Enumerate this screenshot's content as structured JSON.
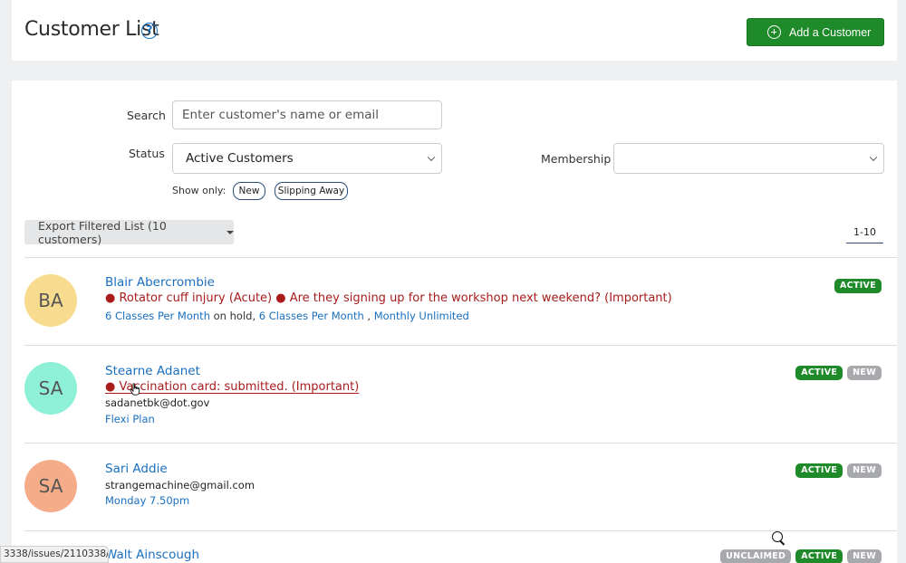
{
  "header": {
    "title": "Customer List",
    "help_glyph": "?",
    "add_button_label": "Add a Customer"
  },
  "filters": {
    "search_label": "Search",
    "search_placeholder": "Enter customer's name or email",
    "status_label": "Status",
    "status_value": "Active Customers",
    "membership_label": "Membership",
    "membership_value": "",
    "show_only_label": "Show only:",
    "show_only_options": [
      "New",
      "Slipping Away"
    ]
  },
  "toolbar": {
    "export_label": "Export Filtered List (10 customers)",
    "pagination": "1-10"
  },
  "customers": [
    {
      "initials": "BA",
      "avatar_color": "#f7dc8f",
      "name": "Blair Abercrombie",
      "note": "● Rotator cuff injury (Acute) ● Are they signing up for the workshop next weekend? (Important)",
      "email": "",
      "plans": [
        "6 Classes Per Month",
        "on hold,",
        "6 Classes Per Month",
        ",",
        "Monthly Unlimited"
      ],
      "badges": [
        "ACTIVE"
      ]
    },
    {
      "initials": "SA",
      "avatar_color": "#8ff0d8",
      "name": "Stearne Adanet",
      "note": "● Vaccination card: submitted. (Important)",
      "email": "sadanetbk@dot.gov",
      "plans": [
        "Flexi Plan"
      ],
      "badges": [
        "ACTIVE",
        "NEW"
      ]
    },
    {
      "initials": "SA",
      "avatar_color": "#f5ac88",
      "name": "Sari Addie",
      "note": "",
      "email": "strangemachine@gmail.com",
      "plans": [
        "Monday 7.50pm"
      ],
      "badges": [
        "ACTIVE",
        "NEW"
      ]
    },
    {
      "initials": "",
      "avatar_color": "#ffffff",
      "name": "Walt Ainscough",
      "note": "",
      "email": "",
      "plans": [],
      "badges": [
        "UNCLAIMED",
        "ACTIVE",
        "NEW"
      ]
    }
  ],
  "statusbar_text": "3338/issues/2110338/",
  "colors": {
    "accent_green": "#1e8a29",
    "link_blue": "#1a6fbf",
    "note_red": "#a81c1c",
    "badge_gray": "#a7a9ac"
  }
}
